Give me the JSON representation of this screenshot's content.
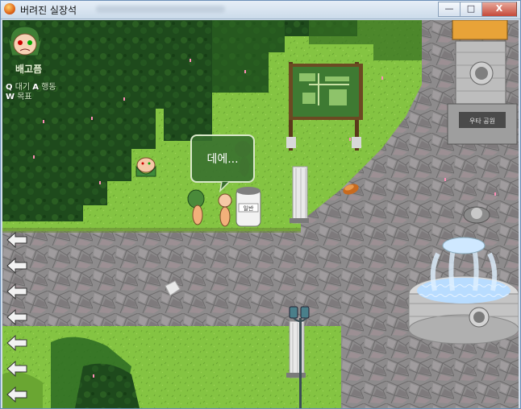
{
  "window": {
    "title": "버려진 실장석",
    "controls": {
      "minimize": "—",
      "maximize": "□",
      "close": "X"
    }
  },
  "hud": {
    "status": "배고픔",
    "hotkeys": [
      {
        "key": "Q",
        "action": "대기"
      },
      {
        "key": "A",
        "action": "행동"
      },
      {
        "key": "W",
        "action": "목표"
      }
    ]
  },
  "dialog": {
    "text": "데에..."
  },
  "trash_can": {
    "label": "일반"
  },
  "fountain_sign": {
    "label": "우타 공원"
  },
  "nav_arrows": [
    {
      "icon": "left-arrow-icon"
    },
    {
      "icon": "left-arrow-icon"
    },
    {
      "icon": "left-arrow-icon"
    },
    {
      "icon": "left-arrow-icon"
    },
    {
      "icon": "left-arrow-icon"
    },
    {
      "icon": "left-arrow-icon"
    },
    {
      "icon": "left-arrow-icon"
    }
  ],
  "colors": {
    "grass": "#7fbf3f",
    "forest": "#1f4d1a",
    "stone": "#8a8a8a",
    "water": "#a9d4ff",
    "bubble": "#376e2d"
  }
}
